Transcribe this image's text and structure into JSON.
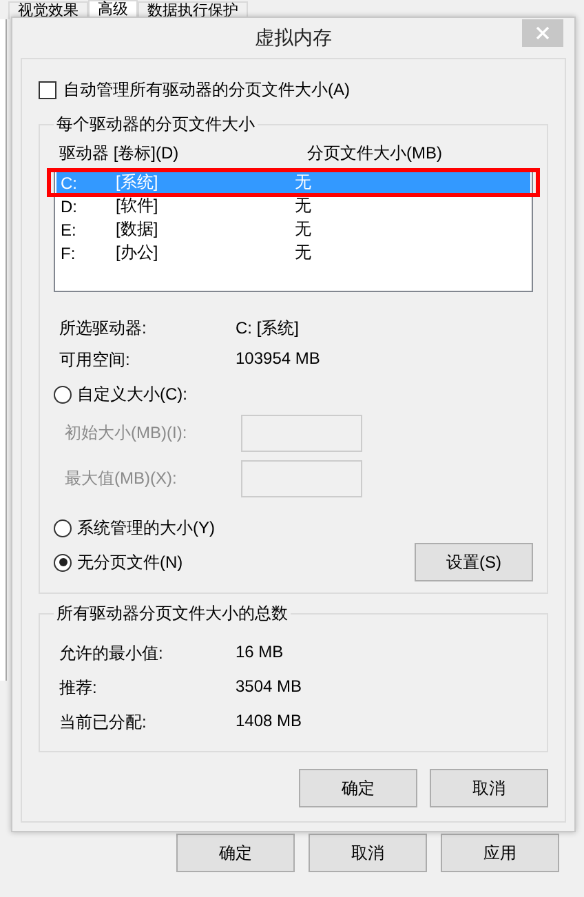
{
  "background_window": {
    "tabs": [
      {
        "label": "视觉效果",
        "selected": false
      },
      {
        "label": "高级",
        "selected": true
      },
      {
        "label": "数据执行保护",
        "selected": false
      }
    ],
    "buttons": [
      "确定",
      "取消",
      "应用"
    ]
  },
  "dialog": {
    "title": "虚拟内存",
    "auto_manage": {
      "label": "自动管理所有驱动器的分页文件大小(A)",
      "checked": false
    },
    "per_drive": {
      "title": "每个驱动器的分页文件大小",
      "columns": [
        "驱动器 [卷标](D)",
        "分页文件大小(MB)"
      ],
      "drives": [
        {
          "drive": "C:",
          "label": "[系统]",
          "size": "无",
          "selected": true,
          "highlighted": true
        },
        {
          "drive": "D:",
          "label": "[软件]",
          "size": "无",
          "selected": false,
          "highlighted": false
        },
        {
          "drive": "E:",
          "label": "[数据]",
          "size": "无",
          "selected": false,
          "highlighted": false
        },
        {
          "drive": "F:",
          "label": "[办公]",
          "size": "无",
          "selected": false,
          "highlighted": false
        }
      ],
      "info": [
        {
          "label": "所选驱动器:",
          "value": "C:  [系统]"
        },
        {
          "label": "可用空间:",
          "value": "103954 MB"
        }
      ],
      "options": [
        {
          "label": "自定义大小(C):",
          "selected": false
        },
        {
          "label": "系统管理的大小(Y)",
          "selected": false
        },
        {
          "label": "无分页文件(N)",
          "selected": true
        }
      ],
      "fields": [
        {
          "label": "初始大小(MB)(I):",
          "disabled": true
        },
        {
          "label": "最大值(MB)(X):",
          "disabled": true
        }
      ],
      "set_button": "设置(S)"
    },
    "totals": {
      "title": "所有驱动器分页文件大小的总数",
      "rows": [
        {
          "label": "允许的最小值:",
          "value": "16 MB"
        },
        {
          "label": "推荐:",
          "value": "3504 MB"
        },
        {
          "label": "当前已分配:",
          "value": "1408 MB"
        }
      ]
    },
    "buttons": [
      "确定",
      "取消"
    ]
  }
}
